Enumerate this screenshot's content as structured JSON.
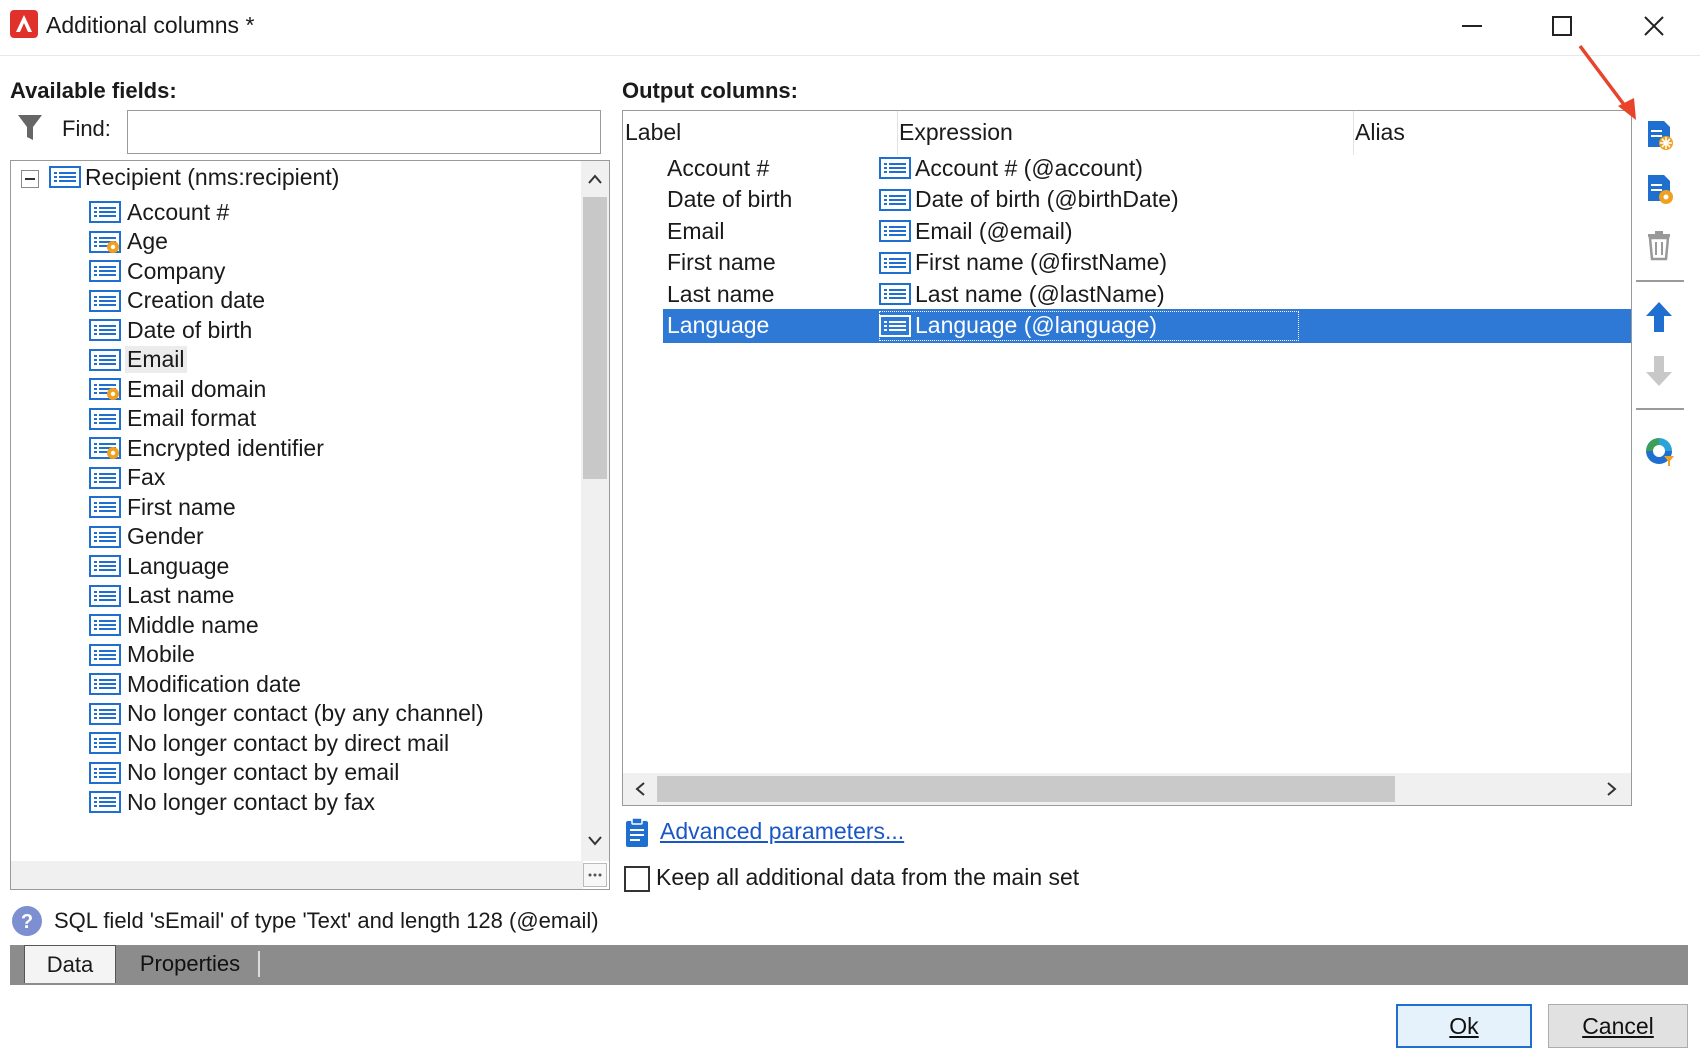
{
  "window": {
    "title": "Additional columns *"
  },
  "left_panel": {
    "heading": "Available fields:",
    "find_label": "Find:",
    "find_value": "",
    "tree": {
      "root_label": "Recipient (nms:recipient)",
      "items": [
        {
          "label": "Account #",
          "icon": "field-icon"
        },
        {
          "label": "Age",
          "icon": "computed-field-icon"
        },
        {
          "label": "Company",
          "icon": "field-icon"
        },
        {
          "label": "Creation date",
          "icon": "field-icon"
        },
        {
          "label": "Date of birth",
          "icon": "field-icon"
        },
        {
          "label": "Email",
          "icon": "field-icon"
        },
        {
          "label": "Email domain",
          "icon": "computed-field-icon"
        },
        {
          "label": "Email format",
          "icon": "field-icon"
        },
        {
          "label": "Encrypted identifier",
          "icon": "computed-field-icon"
        },
        {
          "label": "Fax",
          "icon": "field-icon"
        },
        {
          "label": "First name",
          "icon": "field-icon"
        },
        {
          "label": "Gender",
          "icon": "field-icon"
        },
        {
          "label": "Language",
          "icon": "field-icon"
        },
        {
          "label": "Last name",
          "icon": "field-icon"
        },
        {
          "label": "Middle name",
          "icon": "field-icon"
        },
        {
          "label": "Mobile",
          "icon": "field-icon"
        },
        {
          "label": "Modification date",
          "icon": "field-icon"
        },
        {
          "label": "No longer contact (by any channel)",
          "icon": "field-icon"
        },
        {
          "label": "No longer contact by direct mail",
          "icon": "field-icon"
        },
        {
          "label": "No longer contact by email",
          "icon": "field-icon"
        },
        {
          "label": "No longer contact by fax",
          "icon": "field-icon"
        }
      ]
    }
  },
  "right_panel": {
    "heading": "Output columns:",
    "columns": [
      "Label",
      "Expression",
      "Alias"
    ],
    "rows": [
      {
        "label": "Account #",
        "expression": "Account # (@account)",
        "alias": ""
      },
      {
        "label": "Date of birth",
        "expression": "Date of birth (@birthDate)",
        "alias": ""
      },
      {
        "label": "Email",
        "expression": "Email (@email)",
        "alias": ""
      },
      {
        "label": "First name",
        "expression": "First name (@firstName)",
        "alias": ""
      },
      {
        "label": "Last name",
        "expression": "Last name (@lastName)",
        "alias": ""
      },
      {
        "label": "Language",
        "expression": "Language (@language)",
        "alias": ""
      }
    ],
    "advanced_link": "Advanced parameters...",
    "keep_data_label": "Keep all additional data from the main set"
  },
  "status": {
    "text": "SQL field 'sEmail' of type 'Text' and length 128 (@email)"
  },
  "tabs": [
    "Data",
    "Properties"
  ],
  "buttons": {
    "ok": "Ok",
    "cancel": "Cancel"
  },
  "colors": {
    "selection": "#2e79d6",
    "accent_orange": "#f0a01e",
    "arrow_red": "#e8442c",
    "icon_blue": "#1e6fd0"
  }
}
